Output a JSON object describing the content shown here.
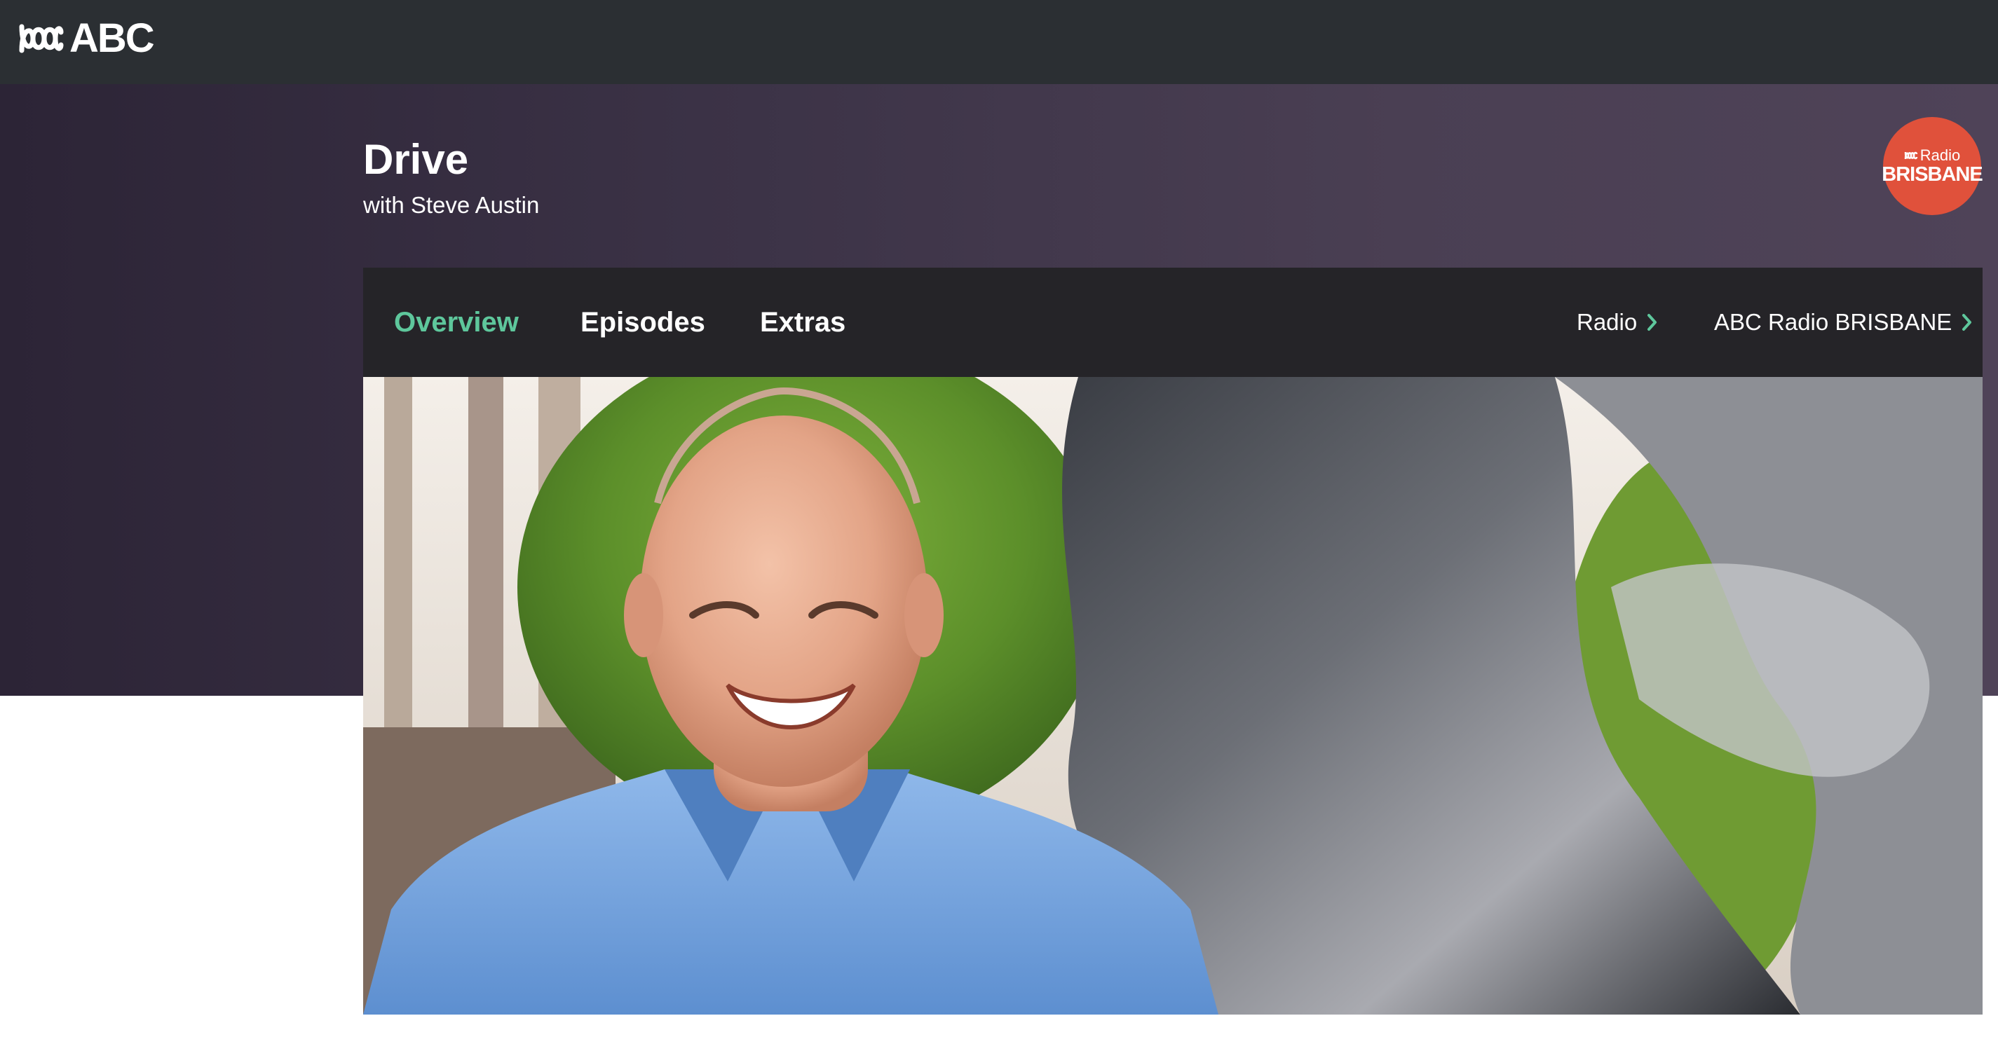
{
  "brand": {
    "logo_text": "ABC",
    "logo_icon": "abc-lissajous-icon"
  },
  "show": {
    "title": "Drive",
    "subtitle": "with Steve Austin"
  },
  "station_badge": {
    "line1": "Radio",
    "line2": "BRISBANE",
    "color": "#e0513b"
  },
  "tabs": [
    {
      "label": "Overview",
      "active": true
    },
    {
      "label": "Episodes",
      "active": false
    },
    {
      "label": "Extras",
      "active": false
    }
  ],
  "breadcrumbs": [
    {
      "label": "Radio",
      "icon": "chevron-right-icon"
    },
    {
      "label": "ABC Radio BRISBANE",
      "icon": "chevron-right-icon"
    }
  ],
  "hero_image": {
    "icon": "presenter-photo"
  },
  "colors": {
    "topbar": "#2b2f33",
    "hero_background": "#3b3246",
    "tabbar": "#252428",
    "accent": "#5ec79c"
  }
}
